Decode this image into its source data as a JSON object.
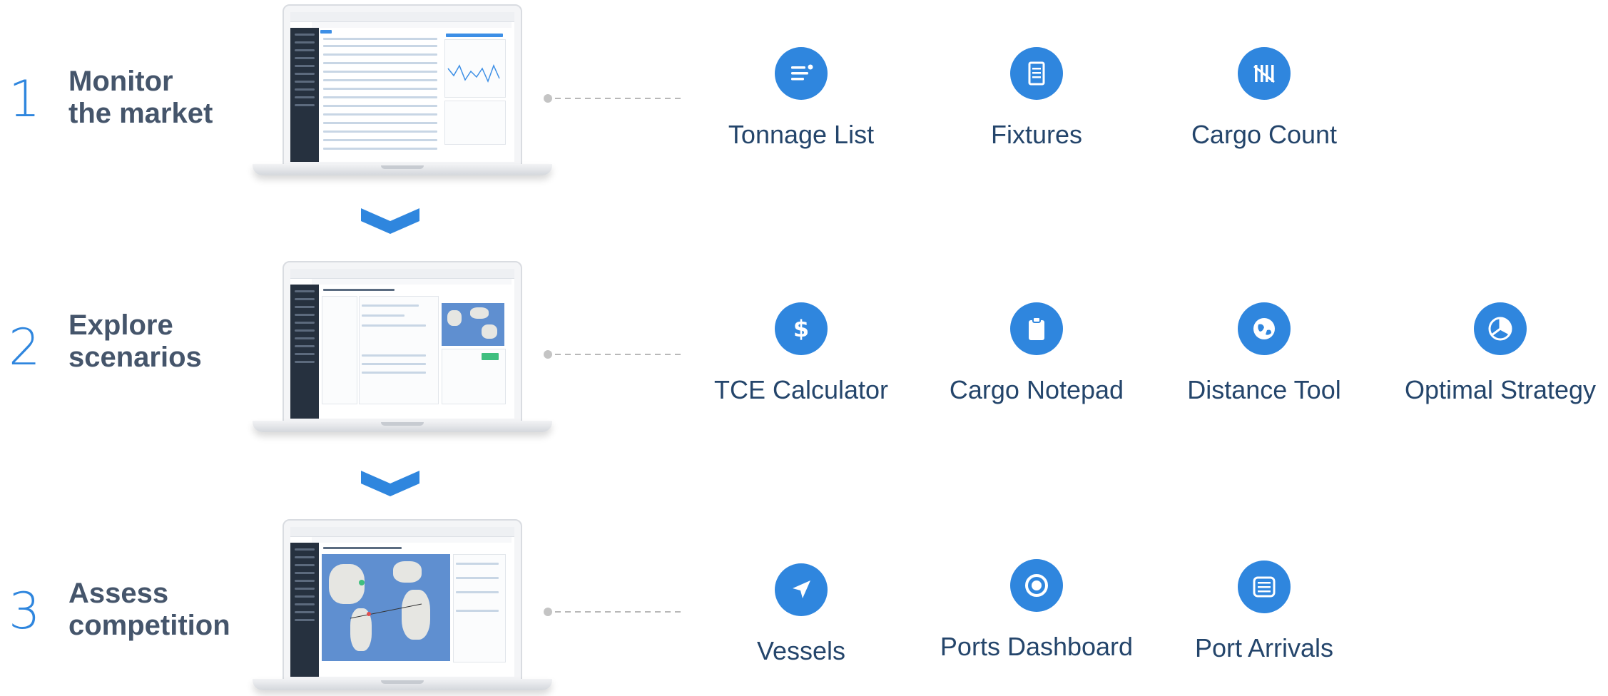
{
  "steps": [
    {
      "number": "1",
      "title_line1": "Monitor",
      "title_line2": "the market",
      "features": [
        {
          "label": "Tonnage List",
          "icon": "list-icon"
        },
        {
          "label": "Fixtures",
          "icon": "document-icon"
        },
        {
          "label": "Cargo Count",
          "icon": "count-icon"
        }
      ]
    },
    {
      "number": "2",
      "title_line1": "Explore",
      "title_line2": "scenarios",
      "features": [
        {
          "label": "TCE Calculator",
          "icon": "dollar-icon"
        },
        {
          "label": "Cargo Notepad",
          "icon": "clipboard-icon"
        },
        {
          "label": "Distance Tool",
          "icon": "globe-icon"
        },
        {
          "label": "Optimal Strategy",
          "icon": "pie-chart-icon"
        }
      ]
    },
    {
      "number": "3",
      "title_line1": "Assess",
      "title_line2": "competition",
      "features": [
        {
          "label": "Vessels",
          "icon": "navigation-arrow-icon"
        },
        {
          "label": "Ports Dashboard",
          "icon": "target-icon"
        },
        {
          "label": "Port Arrivals",
          "icon": "list-box-icon"
        }
      ]
    }
  ],
  "colors": {
    "accent": "#2f86de",
    "title": "#45556b",
    "label": "#24456b"
  }
}
